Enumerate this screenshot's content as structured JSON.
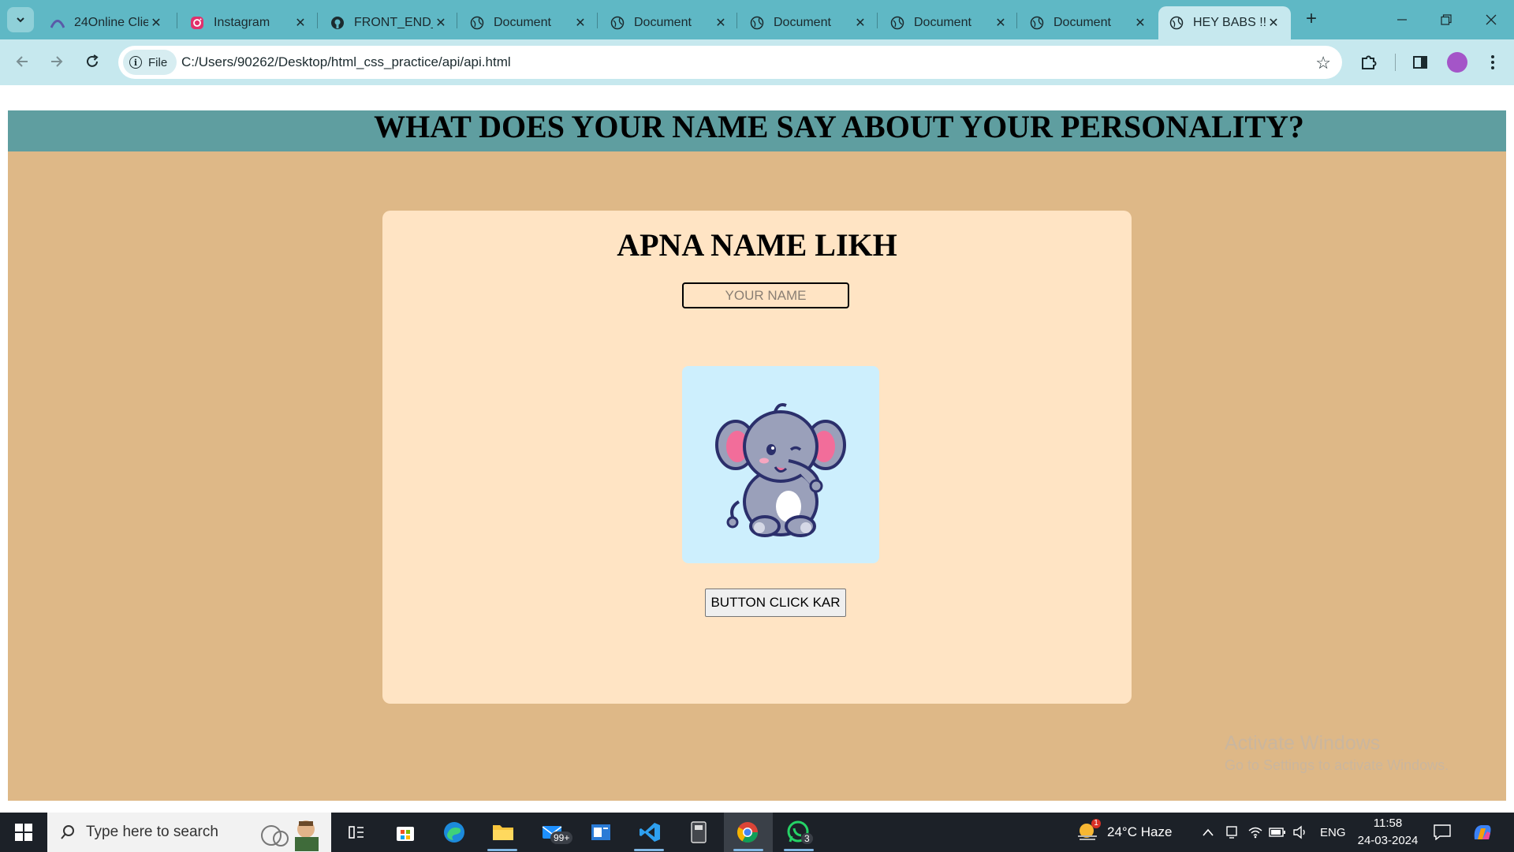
{
  "browser": {
    "tabs": [
      {
        "title": "24Online Clie",
        "icon": "24online-icon",
        "active": false
      },
      {
        "title": "Instagram",
        "icon": "instagram-icon",
        "active": false
      },
      {
        "title": "FRONT_END_",
        "icon": "github-icon",
        "active": false
      },
      {
        "title": "Document",
        "icon": "globe-icon",
        "active": false
      },
      {
        "title": "Document",
        "icon": "globe-icon",
        "active": false
      },
      {
        "title": "Document",
        "icon": "globe-icon",
        "active": false
      },
      {
        "title": "Document",
        "icon": "globe-icon",
        "active": false
      },
      {
        "title": "Document",
        "icon": "globe-icon",
        "active": false
      },
      {
        "title": "HEY BABS !!",
        "icon": "globe-icon",
        "active": true
      }
    ],
    "address": {
      "scheme_label": "File",
      "url": "C:/Users/90262/Desktop/html_css_practice/api/api.html"
    }
  },
  "page": {
    "banner_title": "WHAT DOES YOUR NAME SAY ABOUT YOUR PERSONALITY?",
    "card": {
      "heading": "APNA NAME LIKH",
      "name_input": {
        "placeholder": "YOUR NAME",
        "value": ""
      },
      "image": "cartoon-elephant-image",
      "button_label": "BUTTON CLICK KAR"
    },
    "colors": {
      "page_bg": "#deb887",
      "banner_bg": "#5f9ea0",
      "card_bg": "#ffe4c4",
      "image_bg": "#cdeffd"
    }
  },
  "watermark": {
    "line1": "Activate Windows",
    "line2": "Go to Settings to activate Windows."
  },
  "taskbar": {
    "search_placeholder": "Type here to search",
    "mail_badge": "99+",
    "whatsapp_badge": "3",
    "weather_alert_badge": "1",
    "weather": "24°C  Haze",
    "language": "ENG",
    "time": "11:58",
    "date": "24-03-2024"
  }
}
